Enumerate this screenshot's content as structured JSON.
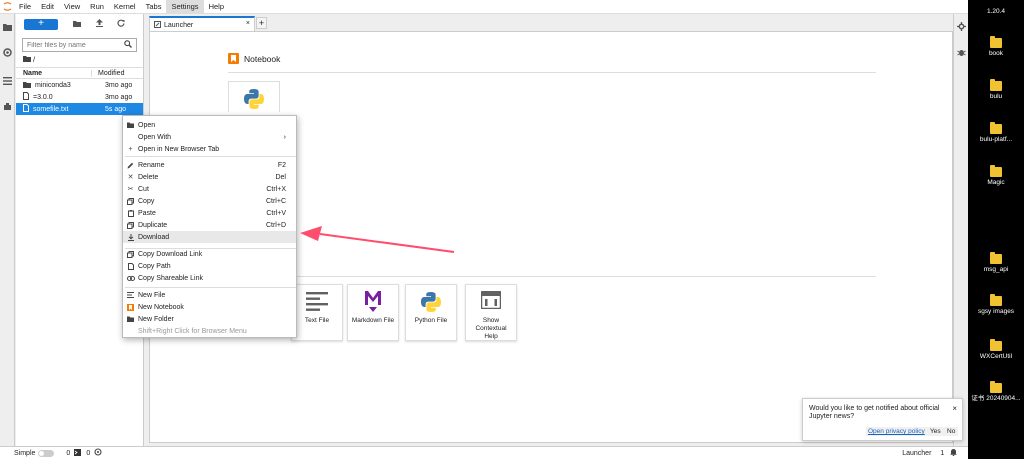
{
  "menubar": {
    "items": [
      "File",
      "Edit",
      "View",
      "Run",
      "Kernel",
      "Tabs",
      "Settings",
      "Help"
    ],
    "active_index": 6
  },
  "filebrowser": {
    "new_label": "+",
    "filter_placeholder": "Filter files by name",
    "breadcrumb": "/",
    "columns": {
      "name": "Name",
      "modified": "Modified"
    },
    "rows": [
      {
        "name": "miniconda3",
        "modified": "3mo ago",
        "type": "folder"
      },
      {
        "name": "=3.0.0",
        "modified": "3mo ago",
        "type": "file"
      },
      {
        "name": "somefile.txt",
        "modified": "5s ago",
        "type": "file",
        "selected": true
      }
    ]
  },
  "tab": {
    "label": "Launcher",
    "close": "×",
    "add": "+"
  },
  "launcher": {
    "notebook_section": "Notebook",
    "cards": [
      {
        "label": "Text File"
      },
      {
        "label": "Markdown File"
      },
      {
        "label": "Python File"
      },
      {
        "label": "Show Contextual Help"
      }
    ]
  },
  "context_menu": {
    "items": [
      {
        "label": "Open",
        "shortcut": "",
        "icon": "folder-icon"
      },
      {
        "label": "Open With",
        "shortcut": "›",
        "icon": ""
      },
      {
        "label": "Open in New Browser Tab",
        "shortcut": "",
        "icon": "plus-icon"
      },
      {
        "label": "Rename",
        "shortcut": "F2",
        "icon": "pencil-icon"
      },
      {
        "label": "Delete",
        "shortcut": "Del",
        "icon": "close-icon"
      },
      {
        "label": "Cut",
        "shortcut": "Ctrl+X",
        "icon": "scissors-icon"
      },
      {
        "label": "Copy",
        "shortcut": "Ctrl+C",
        "icon": "copy-icon"
      },
      {
        "label": "Paste",
        "shortcut": "Ctrl+V",
        "icon": "paste-icon"
      },
      {
        "label": "Duplicate",
        "shortcut": "Ctrl+D",
        "icon": "duplicate-icon"
      },
      {
        "label": "Download",
        "shortcut": "",
        "icon": "download-icon"
      },
      {
        "label": "Copy Download Link",
        "shortcut": "",
        "icon": "copy-icon"
      },
      {
        "label": "Copy Path",
        "shortcut": "",
        "icon": "file-icon"
      },
      {
        "label": "Copy Shareable Link",
        "shortcut": "",
        "icon": "link-icon"
      },
      {
        "label": "New File",
        "shortcut": "",
        "icon": "text-file-icon"
      },
      {
        "label": "New Notebook",
        "shortcut": "",
        "icon": "notebook-icon"
      },
      {
        "label": "New Folder",
        "shortcut": "",
        "icon": "folder-icon"
      },
      {
        "label": "Shift+Right Click for Browser Menu",
        "shortcut": "",
        "icon": ""
      }
    ]
  },
  "statusbar": {
    "mode": "Simple",
    "count1": "0",
    "count2": "0",
    "right_label": "Launcher",
    "right_count": "1"
  },
  "desktop": {
    "icons": [
      "1.20.4",
      "book",
      "bulu",
      "bulu-platf...",
      "Magic",
      "msg_api",
      "sgsy images",
      "WXCertUtil",
      "证书 20240904..."
    ]
  },
  "toast": {
    "message": "Would you like to get notified about official Jupyter news?",
    "privacy_link": "Open privacy policy",
    "yes": "Yes",
    "no": "No",
    "close": "×"
  },
  "colors": {
    "accent": "#1976d2",
    "selection": "#1e88e5",
    "arrow": "#ff4d6d",
    "notebook_orange": "#f57c00"
  }
}
